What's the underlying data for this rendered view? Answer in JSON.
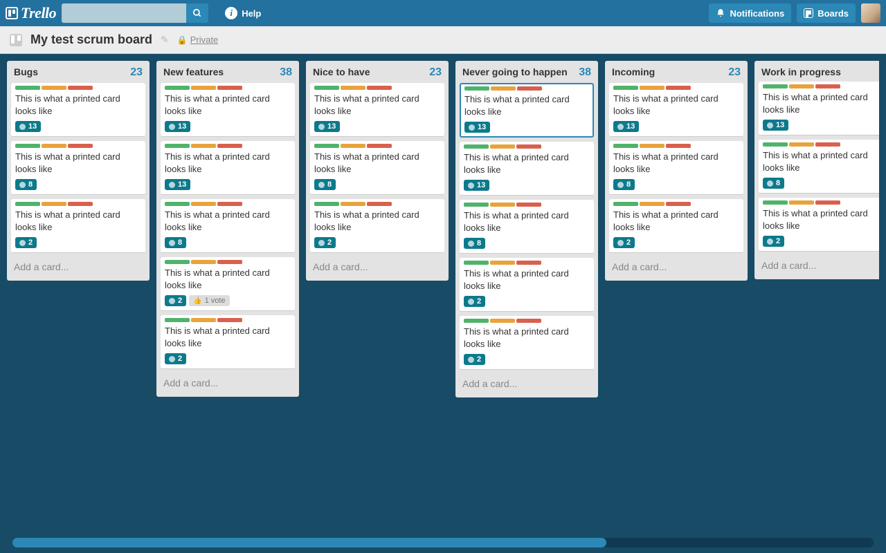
{
  "header": {
    "logo": "Trello",
    "help": "Help",
    "notifications": "Notifications",
    "boards": "Boards"
  },
  "board": {
    "title": "My test scrum board",
    "privacy": "Private"
  },
  "card_text": "This is what a printed card looks like",
  "add_card": "Add a card...",
  "vote_label": "1 vote",
  "lists": [
    {
      "title": "Bugs",
      "count": "23",
      "cards": [
        {
          "points": "13",
          "active": false
        },
        {
          "points": "8",
          "active": false
        },
        {
          "points": "2",
          "active": false
        }
      ]
    },
    {
      "title": "New features",
      "count": "38",
      "cards": [
        {
          "points": "13",
          "active": false
        },
        {
          "points": "13",
          "active": false
        },
        {
          "points": "8",
          "active": false
        },
        {
          "points": "2",
          "active": false,
          "vote": true
        },
        {
          "points": "2",
          "active": false
        }
      ]
    },
    {
      "title": "Nice to have",
      "count": "23",
      "cards": [
        {
          "points": "13",
          "active": false
        },
        {
          "points": "8",
          "active": false
        },
        {
          "points": "2",
          "active": false
        }
      ]
    },
    {
      "title": "Never going to happen",
      "count": "38",
      "cards": [
        {
          "points": "13",
          "active": true
        },
        {
          "points": "13",
          "active": false
        },
        {
          "points": "8",
          "active": false
        },
        {
          "points": "2",
          "active": false
        },
        {
          "points": "2",
          "active": false
        }
      ]
    },
    {
      "title": "Incoming",
      "count": "23",
      "cards": [
        {
          "points": "13",
          "active": false
        },
        {
          "points": "8",
          "active": false
        },
        {
          "points": "2",
          "active": false
        }
      ]
    },
    {
      "title": "Work in progress",
      "count": "",
      "cards": [
        {
          "points": "13",
          "active": false
        },
        {
          "points": "8",
          "active": false
        },
        {
          "points": "2",
          "active": false
        }
      ]
    }
  ]
}
